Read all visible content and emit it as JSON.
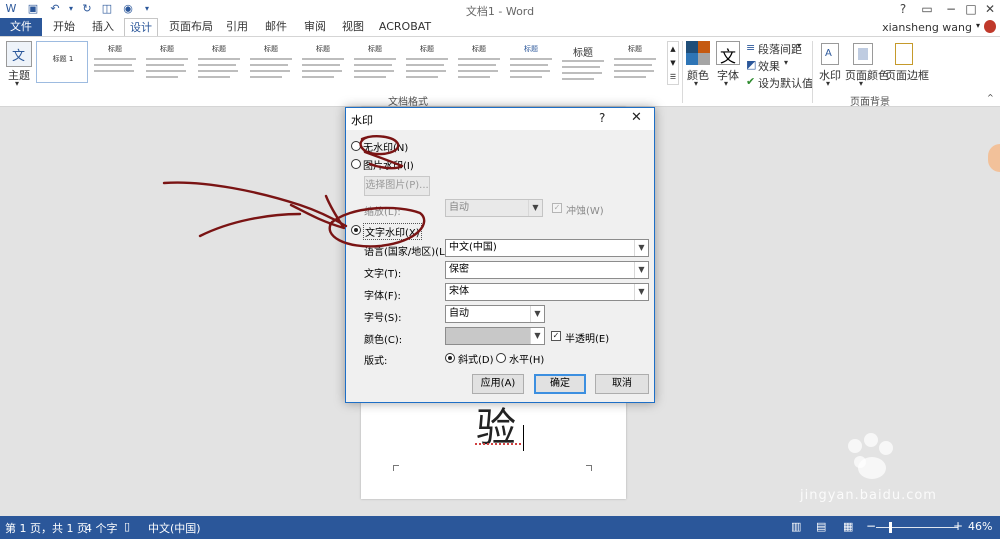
{
  "window": {
    "doc_title": "文档1 - Word",
    "user_name": "xiansheng wang"
  },
  "tabs": [
    {
      "label": "文件"
    },
    {
      "label": "开始"
    },
    {
      "label": "插入"
    },
    {
      "label": "设计"
    },
    {
      "label": "页面布局"
    },
    {
      "label": "引用"
    },
    {
      "label": "邮件"
    },
    {
      "label": "审阅"
    },
    {
      "label": "视图"
    },
    {
      "label": "ACROBAT"
    }
  ],
  "ribbon": {
    "theme_label": "主题",
    "style_thumb_titles": [
      "标题 1",
      "标题",
      "标题",
      "标题",
      "标题",
      "标题",
      "标题",
      "标题",
      "标题",
      "标题",
      "标题",
      "标题"
    ],
    "colors_label": "颜色",
    "fonts_label": "字体",
    "fonts_glyph": "文",
    "paragraph_spacing_label": "段落间距",
    "effects_label": "效果",
    "set_default_label": "设为默认值",
    "doc_format_group": "文档格式",
    "watermark_label": "水印",
    "page_color_label": "页面颜色",
    "page_borders_label": "页面边框",
    "page_bg_group": "页面背景"
  },
  "dialog": {
    "title": "水印",
    "help": "?",
    "close": "✕",
    "no_watermark": "无水印(N)",
    "picture_watermark": "图片水印(I)",
    "select_picture": "选择图片(P)...",
    "scale_label": "缩放(L):",
    "scale_value": "自动",
    "washout": "冲蚀(W)",
    "text_watermark": "文字水印(X)",
    "language_label": "语言(国家/地区)(L):",
    "language_value": "中文(中国)",
    "text_label": "文字(T):",
    "text_value": "保密",
    "font_label": "字体(F):",
    "font_value": "宋体",
    "size_label": "字号(S):",
    "size_value": "自动",
    "color_label": "颜色(C):",
    "semitransparent": "半透明(E)",
    "layout_label": "版式:",
    "diagonal": "斜式(D)",
    "horizontal": "水平(H)",
    "apply": "应用(A)",
    "ok": "确定",
    "cancel": "取消"
  },
  "document": {
    "char": "验"
  },
  "status": {
    "page": "第 1 页，共 1 页",
    "words": "4 个字",
    "language": "中文(中国)",
    "zoom": "46%",
    "zoom_minus": "−",
    "zoom_plus": "+",
    "zoom_fraction": 0.46
  },
  "watermark": {
    "url": "jingyan.baidu.com"
  },
  "colors": {
    "word_blue": "#2b579a",
    "annotation": "#7a1414",
    "dialog_border": "#1e6fc6"
  }
}
